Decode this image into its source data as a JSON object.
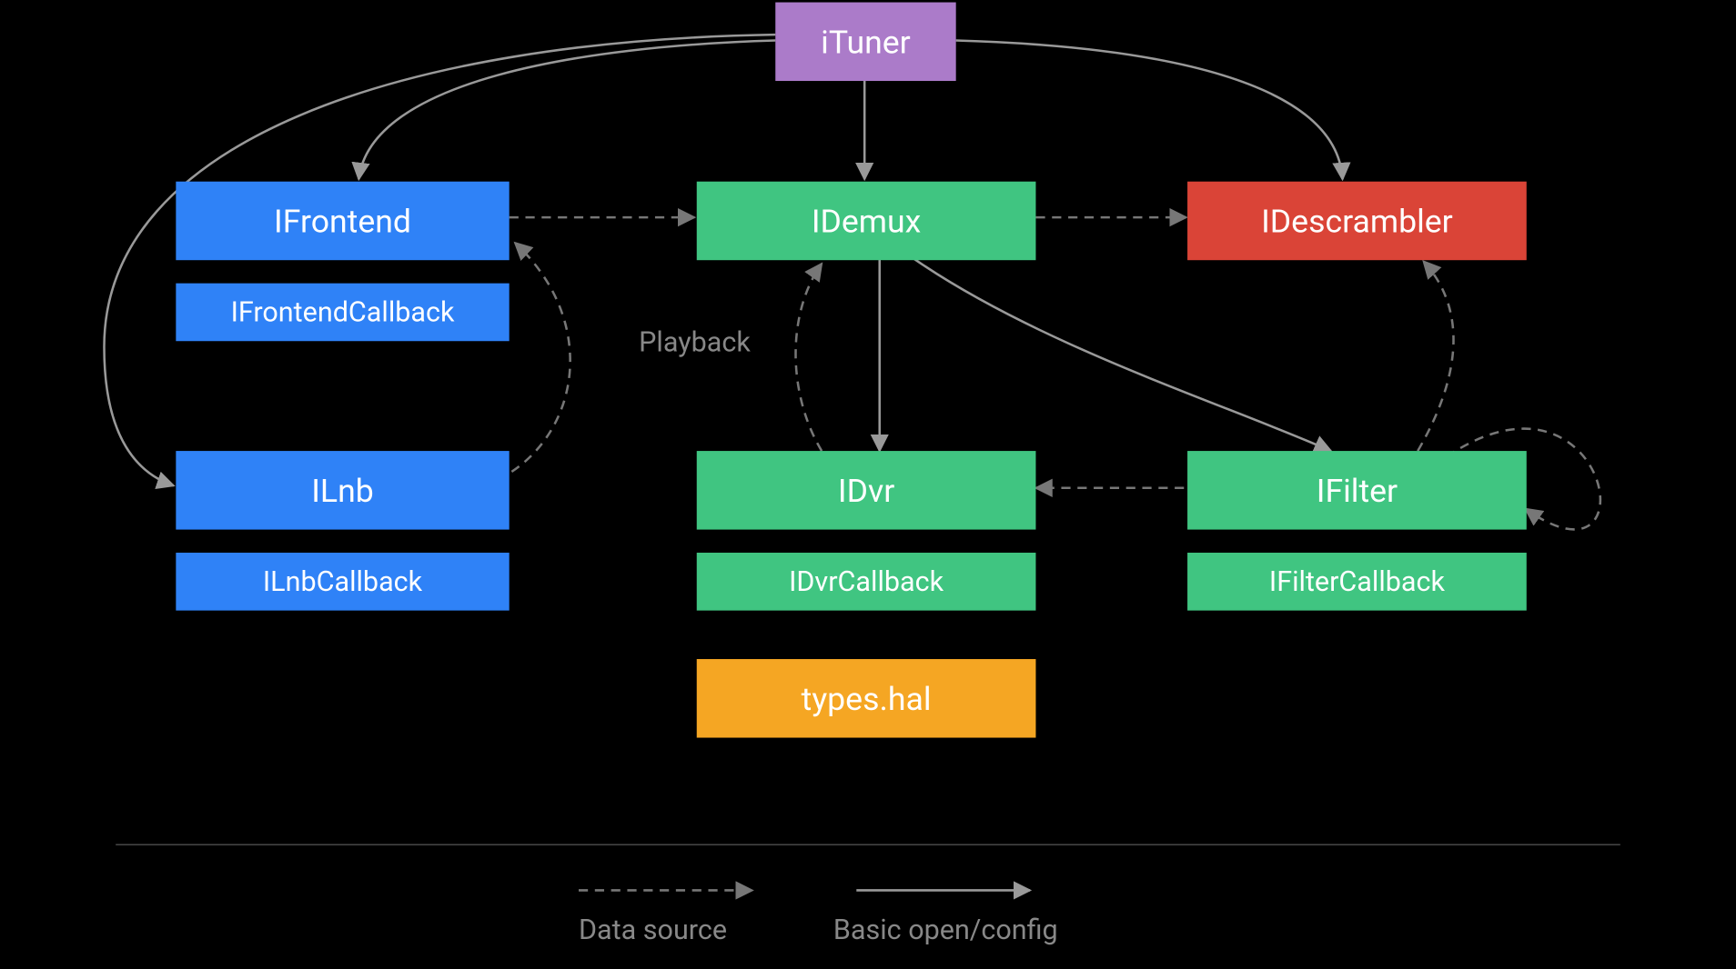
{
  "nodes": {
    "ituner": "iTuner",
    "ifrontend": "IFrontend",
    "ifrontendcallback": "IFrontendCallback",
    "ilnb": "ILnb",
    "ilnbcallback": "ILnbCallback",
    "idemux": "IDemux",
    "idvr": "IDvr",
    "idvrcallback": "IDvrCallback",
    "typeshal": "types.hal",
    "idescrambler": "IDescrambler",
    "ifilter": "IFilter",
    "ifiltercallback": "IFilterCallback"
  },
  "labels": {
    "playback": "Playback"
  },
  "legend": {
    "data_source": "Data source",
    "basic_open_config": "Basic open/config"
  },
  "colors": {
    "purple": "#ab7bc9",
    "blue": "#2f82f7",
    "green": "#40c581",
    "red": "#da4437",
    "orange": "#f5a623",
    "line": "#999999",
    "dashed": "#777777"
  },
  "edges_solid": [
    {
      "from": "iTuner",
      "to": "IFrontend"
    },
    {
      "from": "iTuner",
      "to": "IDemux"
    },
    {
      "from": "iTuner",
      "to": "IDescrambler"
    },
    {
      "from": "iTuner",
      "to": "ILnb"
    },
    {
      "from": "IDemux",
      "to": "IDvr"
    },
    {
      "from": "IDemux",
      "to": "IFilter"
    }
  ],
  "edges_dashed": [
    {
      "from": "IFrontend",
      "to": "IDemux"
    },
    {
      "from": "IDemux",
      "to": "IDescrambler"
    },
    {
      "from": "ILnb",
      "to": "IFrontend"
    },
    {
      "from": "IDvr",
      "to": "IDemux",
      "label": "Playback"
    },
    {
      "from": "IFilter",
      "to": "IDvr"
    },
    {
      "from": "IFilter",
      "to": "IDescrambler"
    },
    {
      "from": "IFilter",
      "to": "IFilter",
      "self_loop": true
    }
  ]
}
